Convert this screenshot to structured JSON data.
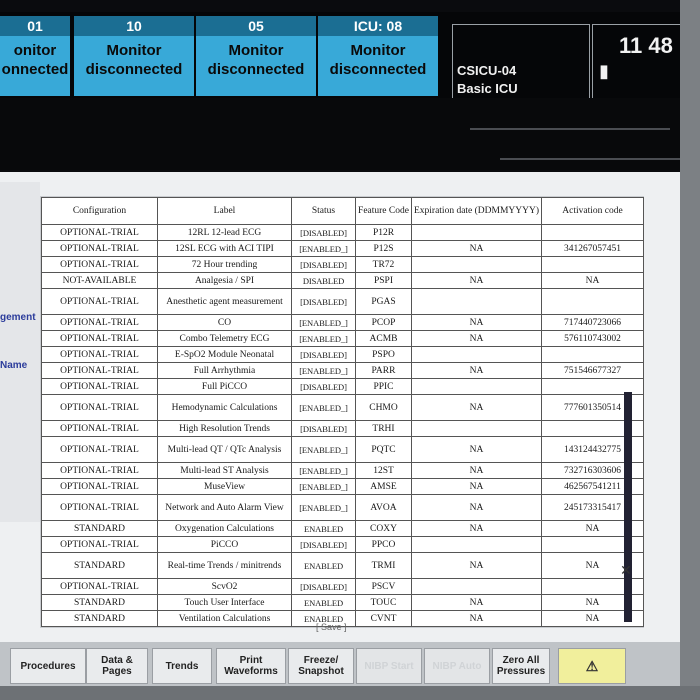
{
  "tiles": [
    {
      "bed": "01",
      "line1": "onitor",
      "line2": "onnected"
    },
    {
      "bed": "10",
      "line1": "Monitor",
      "line2": "disconnected"
    },
    {
      "bed": "05",
      "line1": "Monitor",
      "line2": "disconnected"
    },
    {
      "bed": "ICU: 08",
      "line1": "Monitor",
      "line2": "disconnected"
    }
  ],
  "info": {
    "unit": "CSICU-04",
    "profile": "Basic ICU"
  },
  "clock": {
    "time": "11 48",
    "battery_icon": "battery-icon"
  },
  "left": {
    "item1": "gement",
    "item2": "Name"
  },
  "table": {
    "headers": [
      "Configuration",
      "Label",
      "Status",
      "Feature Code",
      "Expiration date (DDMMYYYY)",
      "Activation code"
    ],
    "rows": [
      [
        "OPTIONAL-TRIAL",
        "12RL 12-lead ECG",
        "[DISABLED]",
        "P12R",
        "",
        ""
      ],
      [
        "OPTIONAL-TRIAL",
        "12SL ECG with ACI TIPI",
        "[ENABLED_]",
        "P12S",
        "NA",
        "341267057451"
      ],
      [
        "OPTIONAL-TRIAL",
        "72 Hour trending",
        "[DISABLED]",
        "TR72",
        "",
        ""
      ],
      [
        "NOT-AVAILABLE",
        "Analgesia / SPI",
        "DISABLED",
        "PSPI",
        "NA",
        "NA"
      ],
      [
        "OPTIONAL-TRIAL",
        "Anesthetic agent measurement",
        "[DISABLED]",
        "PGAS",
        "",
        ""
      ],
      [
        "OPTIONAL-TRIAL",
        "CO",
        "[ENABLED_]",
        "PCOP",
        "NA",
        "717440723066"
      ],
      [
        "OPTIONAL-TRIAL",
        "Combo Telemetry ECG",
        "[ENABLED_]",
        "ACMB",
        "NA",
        "576110743002"
      ],
      [
        "OPTIONAL-TRIAL",
        "E-SpO2 Module Neonatal",
        "[DISABLED]",
        "PSPO",
        "",
        ""
      ],
      [
        "OPTIONAL-TRIAL",
        "Full Arrhythmia",
        "[ENABLED_]",
        "PARR",
        "NA",
        "751546677327"
      ],
      [
        "OPTIONAL-TRIAL",
        "Full PiCCO",
        "[DISABLED]",
        "PPIC",
        "",
        ""
      ],
      [
        "OPTIONAL-TRIAL",
        "Hemodynamic Calculations",
        "[ENABLED_]",
        "CHMO",
        "NA",
        "777601350514"
      ],
      [
        "OPTIONAL-TRIAL",
        "High Resolution Trends",
        "[DISABLED]",
        "TRHI",
        "",
        ""
      ],
      [
        "OPTIONAL-TRIAL",
        "Multi-lead QT / QTc Analysis",
        "[ENABLED_]",
        "PQTC",
        "NA",
        "143124432775"
      ],
      [
        "OPTIONAL-TRIAL",
        "Multi-lead ST Analysis",
        "[ENABLED_]",
        "12ST",
        "NA",
        "732716303606"
      ],
      [
        "OPTIONAL-TRIAL",
        "MuseView",
        "[ENABLED_]",
        "AMSE",
        "NA",
        "462567541211"
      ],
      [
        "OPTIONAL-TRIAL",
        "Network and Auto Alarm View",
        "[ENABLED_]",
        "AVOA",
        "NA",
        "245173315417"
      ],
      [
        "STANDARD",
        "Oxygenation Calculations",
        "ENABLED",
        "COXY",
        "NA",
        "NA"
      ],
      [
        "OPTIONAL-TRIAL",
        "PiCCO",
        "[DISABLED]",
        "PPCO",
        "",
        ""
      ],
      [
        "STANDARD",
        "Real-time Trends / minitrends",
        "ENABLED",
        "TRMI",
        "NA",
        "NA"
      ],
      [
        "OPTIONAL-TRIAL",
        "ScvO2",
        "[DISABLED]",
        "PSCV",
        "",
        ""
      ],
      [
        "STANDARD",
        "Touch User Interface",
        "ENABLED",
        "TOUC",
        "NA",
        "NA"
      ],
      [
        "STANDARD",
        "Ventilation Calculations",
        "ENABLED",
        "CVNT",
        "NA",
        "NA"
      ]
    ]
  },
  "save_label": "[ Save ]",
  "footer": [
    {
      "label": "Procedures",
      "enabled": true
    },
    {
      "label": "Data & Pages",
      "enabled": true
    },
    {
      "label": "Trends",
      "enabled": true
    },
    {
      "label": "Print Waveforms",
      "enabled": true
    },
    {
      "label": "Freeze/ Snapshot",
      "enabled": true
    },
    {
      "label": "NIBP Start",
      "enabled": false
    },
    {
      "label": "NIBP Auto",
      "enabled": false
    },
    {
      "label": "Zero All Pressures",
      "enabled": true
    },
    {
      "label": "",
      "enabled": true,
      "icon": "alarm-bell-icon"
    }
  ]
}
